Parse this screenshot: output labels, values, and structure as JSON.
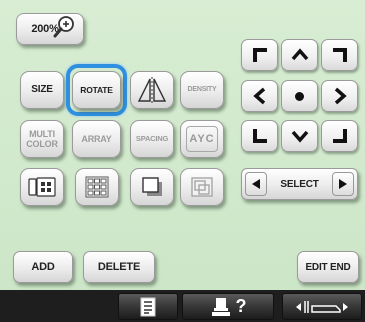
{
  "zoom": {
    "label": "200%"
  },
  "edit_buttons": {
    "size": "SIZE",
    "rotate": "ROTATE",
    "density": "DENSITY",
    "multi_color_line1": "MULTI",
    "multi_color_line2": "COLOR",
    "array": "ARRAY",
    "spacing": "SPACING",
    "character_icon_text": "AYC"
  },
  "select": {
    "label": "SELECT"
  },
  "actions": {
    "add": "ADD",
    "delete": "DELETE",
    "edit_end": "EDIT END"
  },
  "footer": {
    "help_symbol": "?"
  },
  "colors": {
    "background": "#cfe7cb",
    "highlight": "#2f8fe0",
    "footer": "#1e1e1e"
  }
}
